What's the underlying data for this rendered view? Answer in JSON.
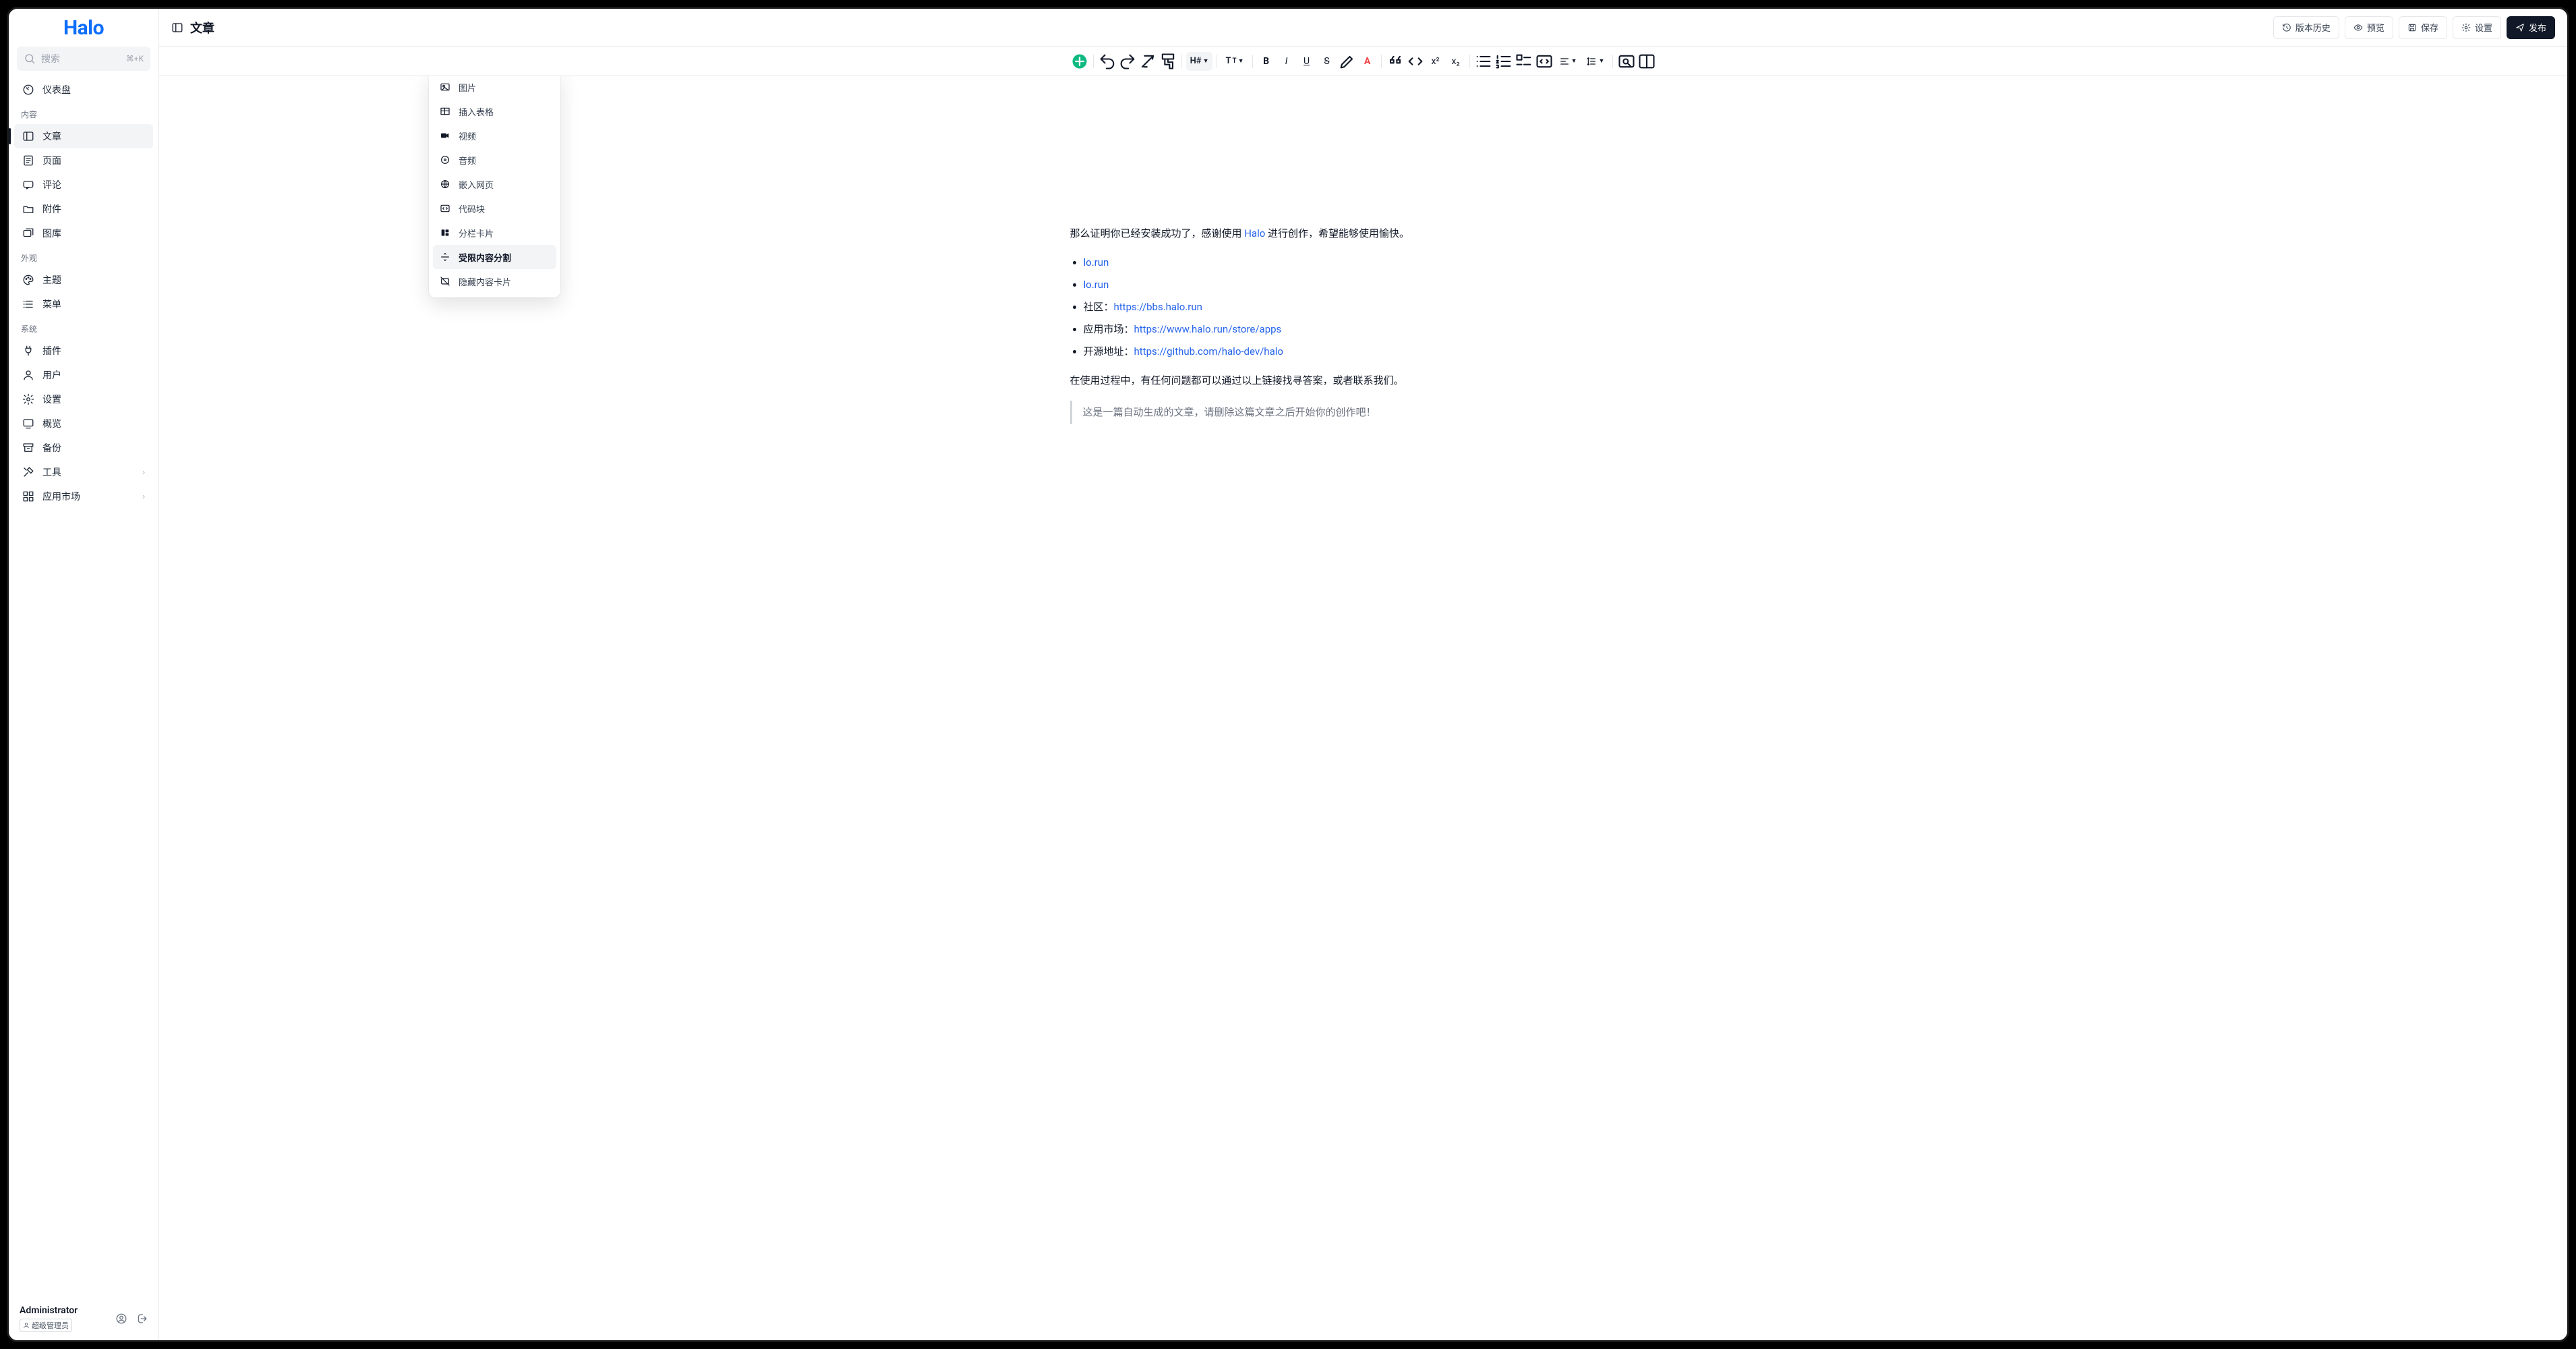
{
  "app": {
    "name": "Halo"
  },
  "search": {
    "placeholder": "搜索",
    "shortcut": "⌘+K"
  },
  "sidebar": {
    "dashboard": "仪表盘",
    "sections": {
      "content": "内容",
      "appearance": "外观",
      "system": "系统"
    },
    "items": {
      "posts": "文章",
      "pages": "页面",
      "comments": "评论",
      "attachments": "附件",
      "photos": "图库",
      "themes": "主题",
      "menus": "菜单",
      "plugins": "插件",
      "users": "用户",
      "settings": "设置",
      "overview": "概览",
      "backup": "备份",
      "tools": "工具",
      "appstore": "应用市场"
    }
  },
  "user": {
    "name": "Administrator",
    "role": "超级管理员"
  },
  "header": {
    "title": "文章",
    "history": "版本历史",
    "preview": "预览",
    "save": "保存",
    "settings": "设置",
    "publish": "发布"
  },
  "dropdown": {
    "image": "图片",
    "table": "插入表格",
    "video": "视频",
    "audio": "音频",
    "iframe": "嵌入网页",
    "code": "代码块",
    "columns": "分栏卡片",
    "restricted": "受限内容分割",
    "hidden": "隐藏内容卡片"
  },
  "content": {
    "intro_prefix": "那么证明你已经安装成功了，感谢使用 ",
    "intro_link": "Halo",
    "intro_suffix": " 进行创作，希望能够使用愉快。",
    "links": [
      {
        "label": "lo.run",
        "url": "lo.run"
      },
      {
        "label": "lo.run",
        "url": "lo.run"
      },
      {
        "label": "社区：",
        "url": "https://bbs.halo.run"
      },
      {
        "label": "应用市场：",
        "url": "https://www.halo.run/store/apps"
      },
      {
        "label": "开源地址：",
        "url": "https://github.com/halo-dev/halo"
      }
    ],
    "help": "在使用过程中，有任何问题都可以通过以上链接找寻答案，或者联系我们。",
    "quote": "这是一篇自动生成的文章，请删除这篇文章之后开始你的创作吧！"
  }
}
